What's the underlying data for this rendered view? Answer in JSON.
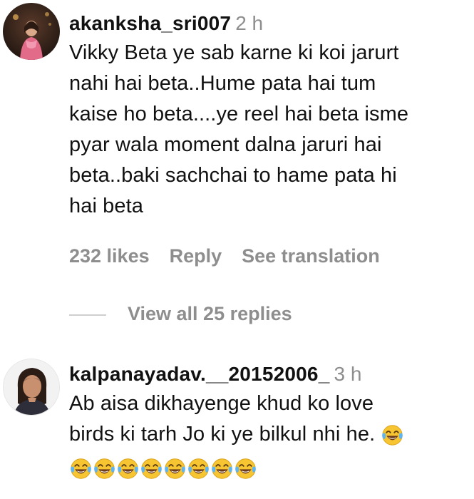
{
  "comments": [
    {
      "username": "akanksha_sri007",
      "time": "2 h",
      "text": "Vikky Beta ye sab karne ki koi jarurt\nnahi hai beta..Hume pata hai tum\nkaise ho beta....ye reel hai beta isme\npyar wala moment dalna jaruri hai\nbeta..baki sachchai to hame pata hi\nhai beta",
      "likes": "232 likes",
      "reply_label": "Reply",
      "translate_label": "See translation",
      "view_replies": "View all 25 replies"
    },
    {
      "username": "kalpanayadav.__20152006_",
      "time": "3 h",
      "text_line1": "Ab aisa dikhayenge khud ko love",
      "text_line2": "birds ki tarh Jo ki ye bilkul nhi he.",
      "emoji_name": "face-with-tears-of-joy-icon",
      "emoji_count_inline": 1,
      "emoji_count_row": 8
    }
  ],
  "colors": {
    "text": "#111111",
    "muted": "#8e8e8e",
    "divider": "#cfcfcf",
    "emoji_yellow": "#f7c531"
  }
}
